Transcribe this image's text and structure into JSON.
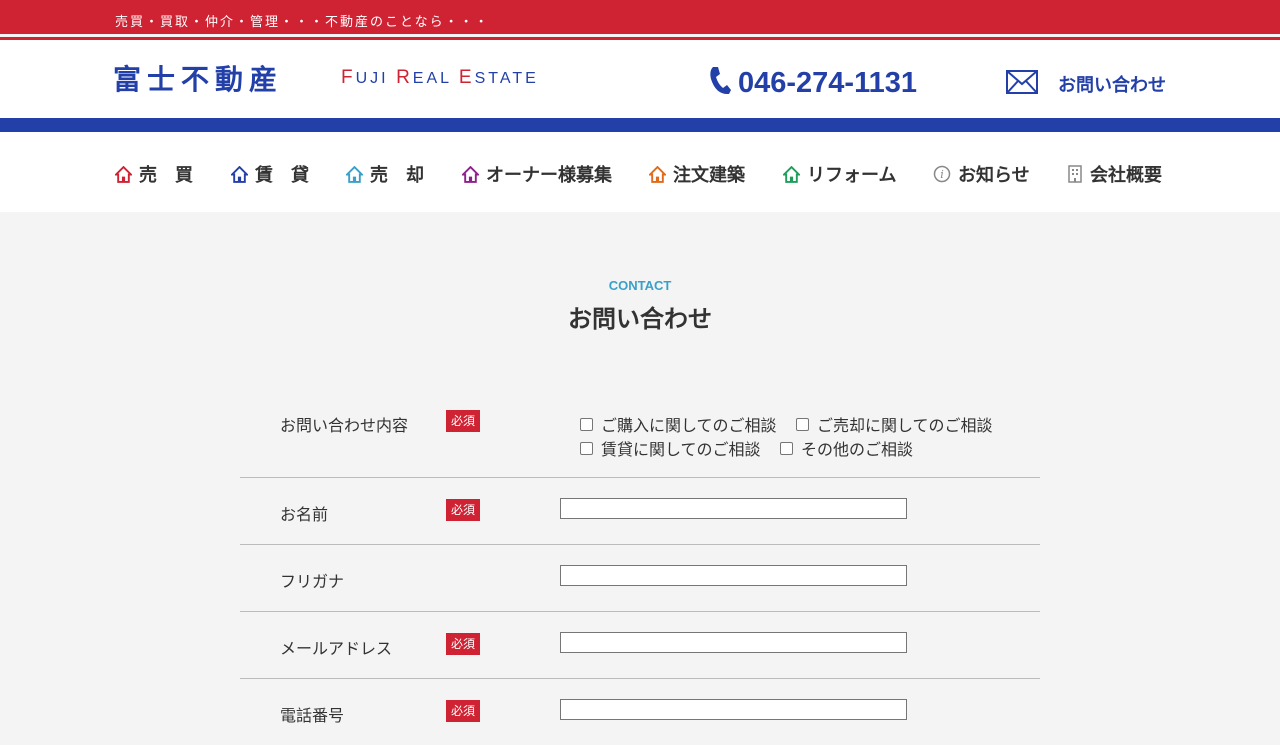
{
  "topbar": {
    "tagline": "売買・買取・仲介・管理・・・不動産のことなら・・・"
  },
  "logo": {
    "jp": "富士不動産",
    "en_parts": [
      "F",
      "UJI ",
      "R",
      "EAL ",
      "E",
      "STATE"
    ]
  },
  "contact": {
    "phone": "046-274-1131",
    "inquiry_label": "お問い合わせ"
  },
  "colors": {
    "brand_red": "#cf2233",
    "brand_blue": "#2340a8",
    "accent_cyan": "#3aa0c8"
  },
  "nav": [
    {
      "label": "売　買",
      "icon": "house-icon",
      "color": "#cf2233"
    },
    {
      "label": "賃　貸",
      "icon": "house-icon",
      "color": "#2340a8"
    },
    {
      "label": "売　却",
      "icon": "house-icon",
      "color": "#3aa0c8"
    },
    {
      "label": "オーナー様募集",
      "icon": "house-icon",
      "color": "#8e1f8e"
    },
    {
      "label": "注文建築",
      "icon": "house-icon",
      "color": "#e06a1b"
    },
    {
      "label": "リフォーム",
      "icon": "house-icon",
      "color": "#1e9e5a"
    },
    {
      "label": "お知らせ",
      "icon": "info-icon",
      "color": "#888888"
    },
    {
      "label": "会社概要",
      "icon": "building-icon",
      "color": "#888888"
    }
  ],
  "section": {
    "en": "CONTACT",
    "jp": "お問い合わせ"
  },
  "form": {
    "required_label": "必須",
    "inquiry": {
      "label": "お問い合わせ内容",
      "options": [
        "ご購入に関してのご相談",
        "ご売却に関してのご相談",
        "賃貸に関してのご相談",
        "その他のご相談"
      ]
    },
    "name": {
      "label": "お名前",
      "value": ""
    },
    "furigana": {
      "label": "フリガナ",
      "value": ""
    },
    "email": {
      "label": "メールアドレス",
      "value": ""
    },
    "tel": {
      "label": "電話番号",
      "value": ""
    }
  }
}
